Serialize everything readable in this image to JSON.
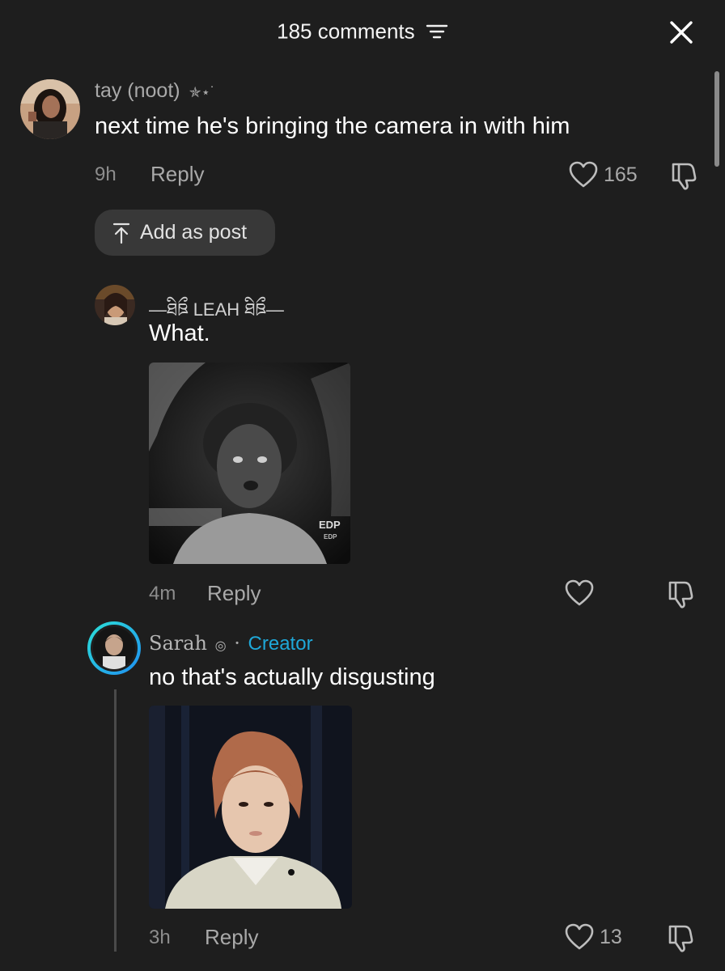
{
  "header": {
    "comment_count": "185 comments",
    "sort_icon": "sort-lines-icon",
    "close_icon": "close-icon"
  },
  "comments": [
    {
      "name": "tay (noot)",
      "badge": "✯⋆˙",
      "text": "next time he's bringing the camera in with him",
      "time": "9h",
      "reply_label": "Reply",
      "likes": "165"
    },
    {
      "name": "—ཐིཋྀ LEAH ཐིཋྀ—",
      "text": "What.",
      "time": "4m",
      "reply_label": "Reply",
      "likes": ""
    },
    {
      "name": "Sarah",
      "badge": "◎",
      "separator": "·",
      "creator_label": "Creator",
      "text": "no that's actually disgusting",
      "time": "3h",
      "reply_label": "Reply",
      "likes": "13"
    }
  ],
  "add_post_label": "Add as post",
  "overlay_texts": {
    "edp": "EDP",
    "edp_small": "EDP"
  },
  "colors": {
    "background": "#1e1e1e",
    "creator": "#1fa8d8",
    "secondary_text": "#a9a9a9"
  }
}
